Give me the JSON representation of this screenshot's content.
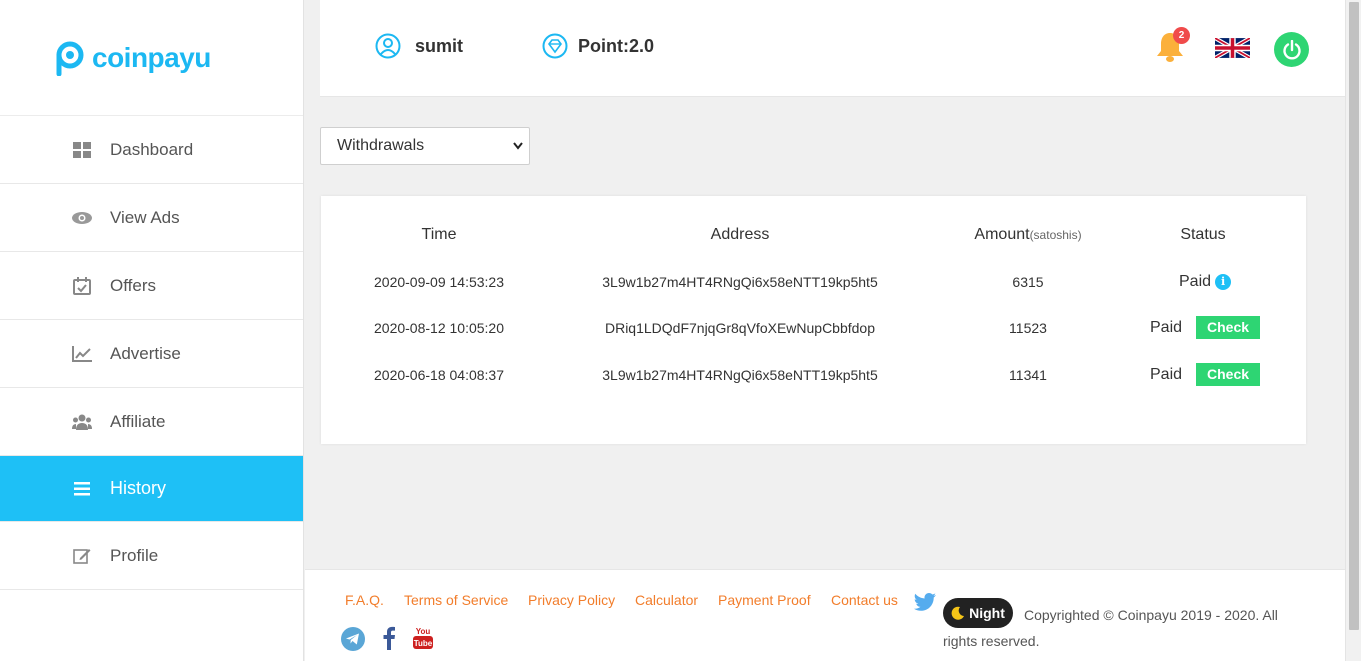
{
  "brand": {
    "name": "coinpayu",
    "color": "#1cb8f2"
  },
  "sidebar": {
    "items": [
      {
        "label": "Dashboard",
        "icon": "dashboard-grid-icon",
        "active": false
      },
      {
        "label": "View Ads",
        "icon": "eye-icon",
        "active": false
      },
      {
        "label": "Offers",
        "icon": "calendar-check-icon",
        "active": false
      },
      {
        "label": "Advertise",
        "icon": "line-chart-icon",
        "active": false
      },
      {
        "label": "Affiliate",
        "icon": "users-icon",
        "active": false
      },
      {
        "label": "History",
        "icon": "list-icon",
        "active": true
      },
      {
        "label": "Profile",
        "icon": "edit-icon",
        "active": false
      }
    ]
  },
  "header": {
    "username": "sumit",
    "points": "Point:2.0",
    "notification_count": "2",
    "language_icon": "uk-flag-icon",
    "power_color": "#2ed573"
  },
  "history_select": {
    "selected": "Withdrawals"
  },
  "table": {
    "headers": {
      "time": "Time",
      "address": "Address",
      "amount": "Amount",
      "amount_unit": "(satoshis)",
      "status": "Status"
    },
    "rows": [
      {
        "time": "2020-09-09 14:53:23",
        "address": "3L9w1b27m4HT4RNgQi6x58eNTT19kp5ht5",
        "amount": "6315",
        "status": "Paid",
        "has_check": false
      },
      {
        "time": "2020-08-12 10:05:20",
        "address": "DRiq1LDQdF7njqGr8qVfoXEwNupCbbfdop",
        "amount": "11523",
        "status": "Paid",
        "has_check": true
      },
      {
        "time": "2020-06-18 04:08:37",
        "address": "3L9w1b27m4HT4RNgQi6x58eNTT19kp5ht5",
        "amount": "11341",
        "status": "Paid",
        "has_check": true
      }
    ],
    "check_label": "Check",
    "info_glyph": "i",
    "accent": "#2ed573"
  },
  "footer": {
    "links": [
      "F.A.Q.",
      "Terms of Service",
      "Privacy Policy",
      "Calculator",
      "Payment Proof",
      "Contact us"
    ],
    "link_color": "#f27d2b",
    "night_label": "Night",
    "copyright": "Copyrighted © Coinpayu 2019 - 2020. All rights reserved."
  }
}
